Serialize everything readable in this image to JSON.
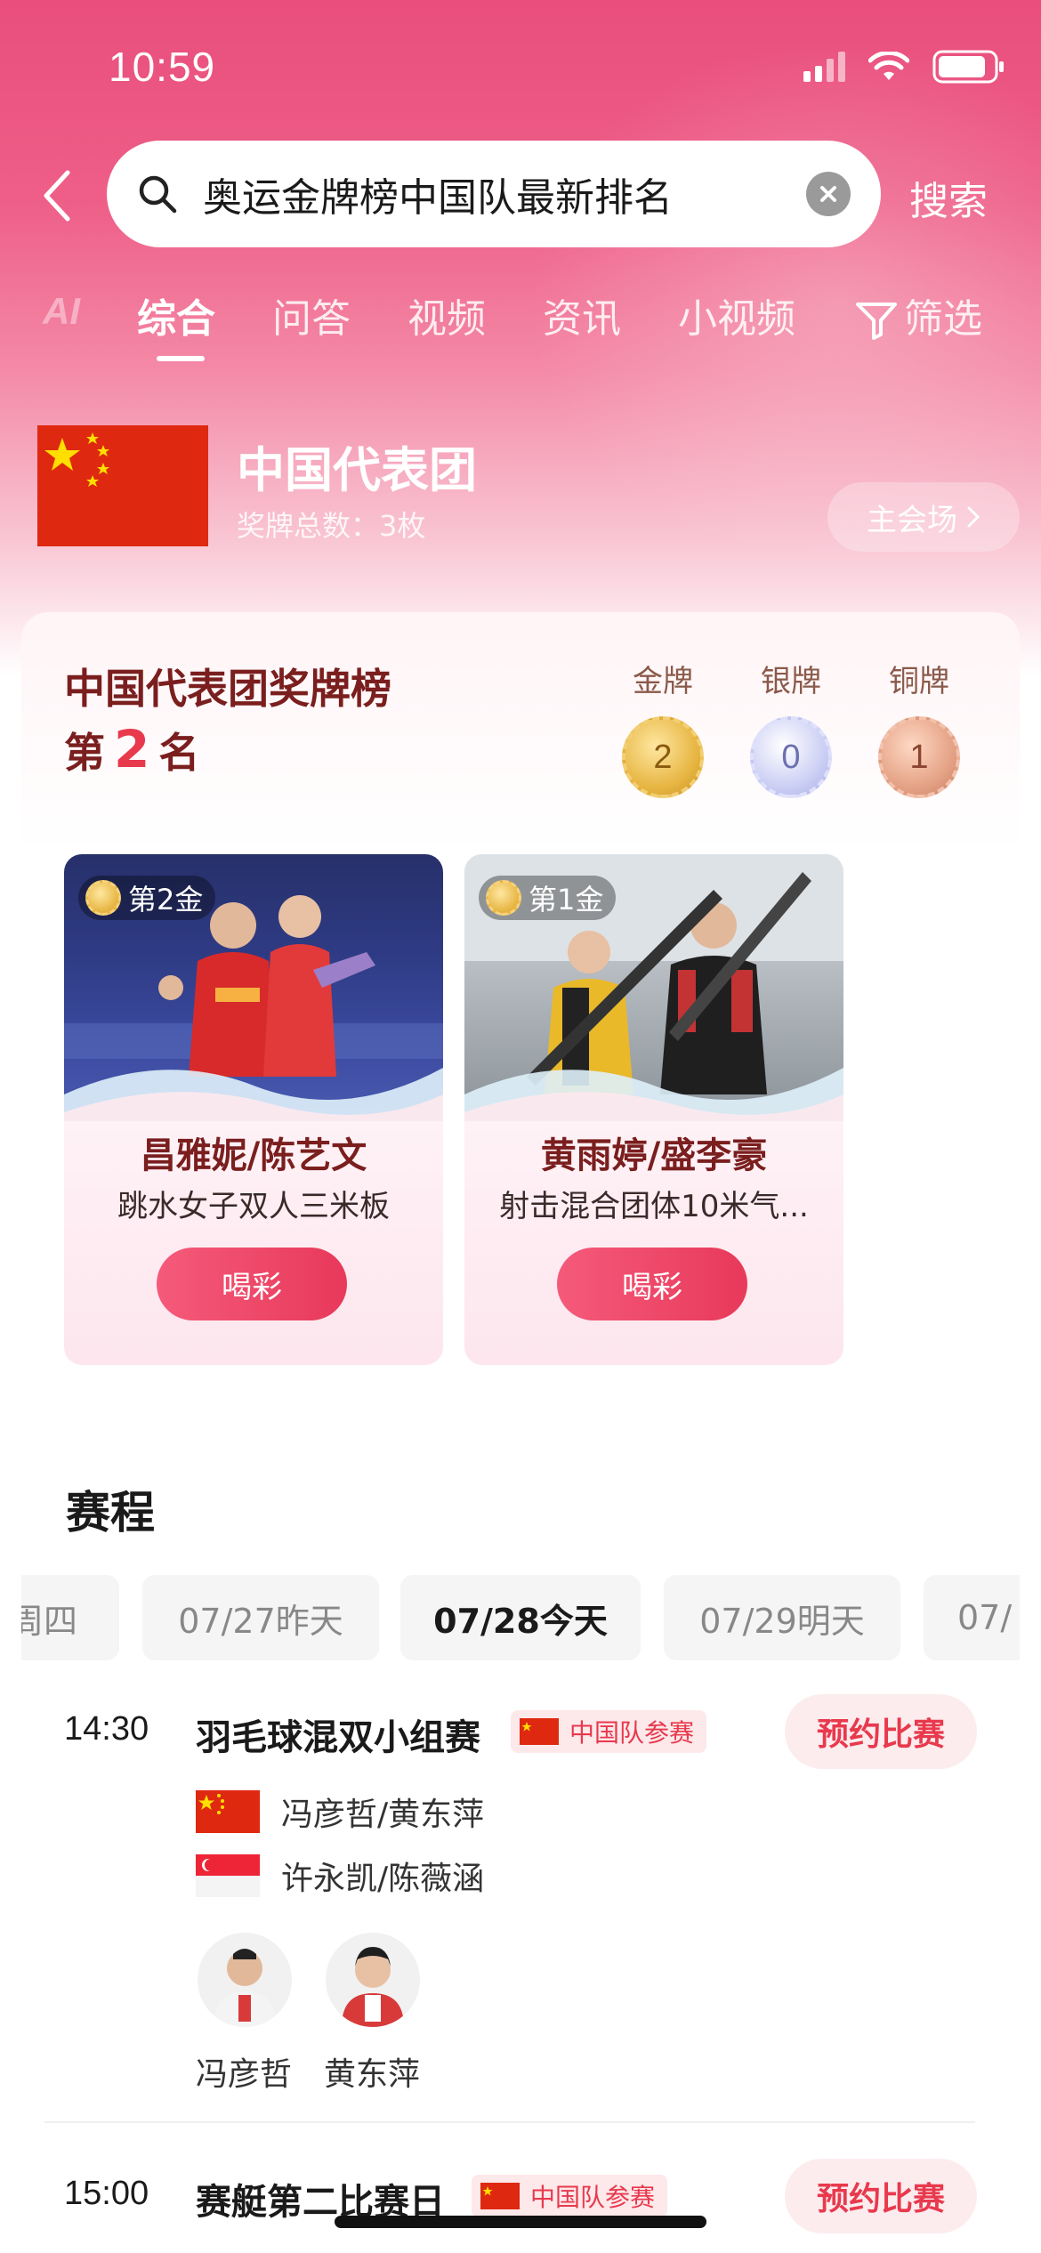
{
  "status_bar": {
    "time": "10:59"
  },
  "search": {
    "query": "奥运金牌榜中国队最新排名",
    "button_label": "搜索"
  },
  "tabs": [
    {
      "label": "综合"
    },
    {
      "label": "问答"
    },
    {
      "label": "视频"
    },
    {
      "label": "资讯"
    },
    {
      "label": "小视频"
    },
    {
      "label": "筛选"
    }
  ],
  "ai_tag": "AI",
  "delegation": {
    "name": "中国代表团",
    "medal_total": "奖牌总数：3枚",
    "venue_button": "主会场"
  },
  "medal_table": {
    "title": "中国代表团奖牌榜",
    "rank_prefix": "第",
    "rank": "2",
    "rank_suffix": "名",
    "gold_label": "金牌",
    "gold": "2",
    "silver_label": "银牌",
    "silver": "0",
    "bronze_label": "铜牌",
    "bronze": "1"
  },
  "gold_cards": [
    {
      "tag": "第2金",
      "athletes": "昌雅妮/陈艺文",
      "event": "跳水女子双人三米板",
      "cheer": "喝彩"
    },
    {
      "tag": "第1金",
      "athletes": "黄雨婷/盛李豪",
      "event": "射击混合团体10米气...",
      "cheer": "喝彩"
    }
  ],
  "schedule": {
    "title": "赛程",
    "dates": [
      "周四",
      "07/27昨天",
      "07/28今天",
      "07/29明天",
      "07/"
    ],
    "matches": [
      {
        "time": "14:30",
        "name": "羽毛球混双小组赛",
        "badge": "中国队参赛",
        "reserve": "预约比赛",
        "team_a": "冯彦哲/黄东萍",
        "team_b": "许永凯/陈薇涵",
        "players": [
          "冯彦哲",
          "黄东萍"
        ]
      },
      {
        "time": "15:00",
        "name": "赛艇第二比赛日",
        "badge": "中国队参赛",
        "reserve": "预约比赛"
      }
    ]
  },
  "colors": {
    "brand_pink": "#e94e7c",
    "accent_red": "#e8394d",
    "china_red": "#de2910",
    "title_brown": "#7a1e1e"
  }
}
